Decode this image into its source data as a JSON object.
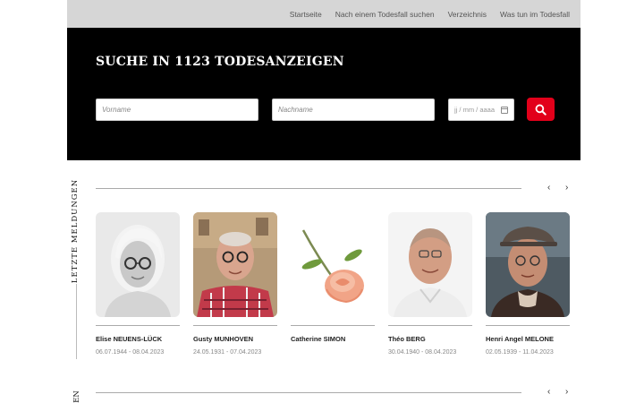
{
  "nav": {
    "items": [
      "Startseite",
      "Nach einem Todesfall suchen",
      "Verzeichnis",
      "Was tun im Todesfall"
    ]
  },
  "hero": {
    "title": "SUCHE IN 1123 TODESANZEIGEN",
    "firstname_placeholder": "Vorname",
    "lastname_placeholder": "Nachname",
    "date_placeholder": "jj / mm / aaaa"
  },
  "sections": {
    "latest_label": "LETZTE MELDUNGEN",
    "next_label_partial": "EN"
  },
  "cards": [
    {
      "name": "Elise NEUENS-LÜCK",
      "dates": "06.07.1944 - 08.04.2023"
    },
    {
      "name": "Gusty MUNHOVEN",
      "dates": "24.05.1931 - 07.04.2023"
    },
    {
      "name": "Catherine SIMON",
      "dates": ""
    },
    {
      "name": "Théo BERG",
      "dates": "30.04.1940 - 08.04.2023"
    },
    {
      "name": "Henri Angel MELONE",
      "dates": "02.05.1939 - 11.04.2023"
    }
  ],
  "colors": {
    "accent": "#e2001a",
    "hero_bg": "#000000",
    "nav_bg": "#d6d6d6"
  },
  "icons": {
    "search": "search-icon",
    "calendar": "calendar-icon",
    "prev": "chevron-left-icon",
    "next": "chevron-right-icon"
  }
}
